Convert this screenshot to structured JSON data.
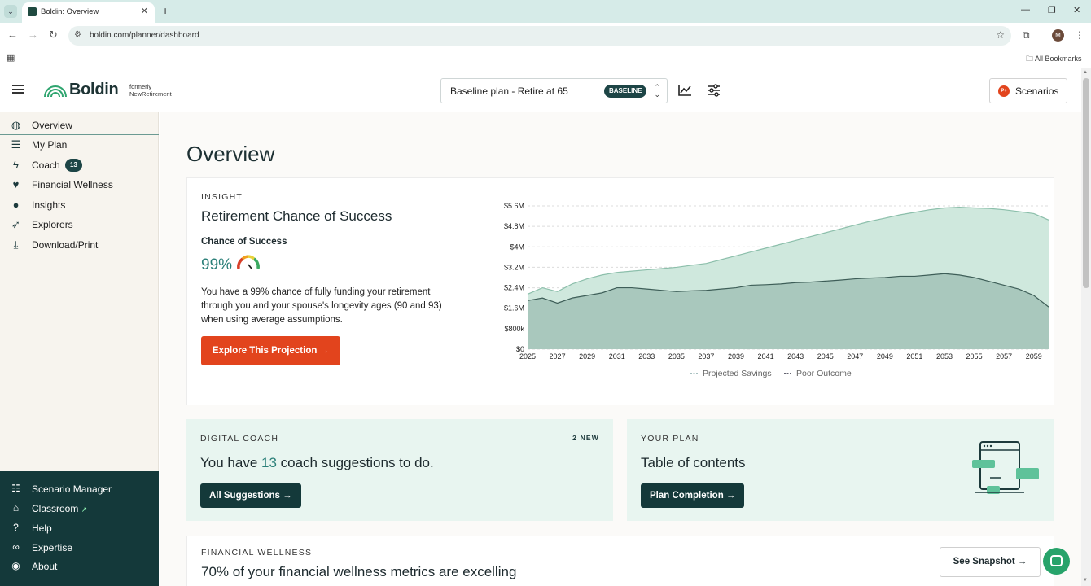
{
  "browser": {
    "tab_title": "Boldin: Overview",
    "tab_close": "✕",
    "new_tab": "+",
    "url": "boldin.com/planner/dashboard",
    "bookmarks_label": "All Bookmarks",
    "profile_initial": "M"
  },
  "header": {
    "brand": "Boldin",
    "formerly_line1": "formerly",
    "formerly_line2": "NewRetirement",
    "plan_name": "Baseline plan - Retire at 65",
    "plan_badge": "BASELINE",
    "scenarios_label": "Scenarios",
    "scenarios_icon_text": "P+"
  },
  "sidebar": {
    "items": [
      {
        "label": "Overview",
        "icon": "globe-icon"
      },
      {
        "label": "My Plan",
        "icon": "checklist-icon"
      },
      {
        "label": "Coach",
        "icon": "lightning-icon",
        "badge": "13"
      },
      {
        "label": "Financial Wellness",
        "icon": "heartbeat-icon"
      },
      {
        "label": "Insights",
        "icon": "lightbulb-icon"
      },
      {
        "label": "Explorers",
        "icon": "explorer-icon"
      },
      {
        "label": "Download/Print",
        "icon": "download-icon"
      }
    ],
    "bottom_items": [
      {
        "label": "Scenario Manager",
        "icon": "signpost-icon"
      },
      {
        "label": "Classroom",
        "icon": "graduation-cap-icon"
      },
      {
        "label": "Help",
        "icon": "question-icon"
      },
      {
        "label": "Expertise",
        "icon": "glasses-icon"
      },
      {
        "label": "About",
        "icon": "compass-icon"
      }
    ]
  },
  "main": {
    "page_title": "Overview",
    "insight": {
      "eyebrow": "INSIGHT",
      "title": "Retirement Chance of Success",
      "cos_label": "Chance of Success",
      "cos_value": "99%",
      "text": "You have a 99% chance of fully funding your retirement through you and your spouse's longevity ages (90 and 93) when using average assumptions.",
      "button_label": "Explore This Projection →"
    },
    "coach": {
      "eyebrow": "DIGITAL COACH",
      "new_tag": "2 NEW",
      "headline_before": "You have ",
      "headline_count": "13",
      "headline_after": " coach suggestions to do.",
      "button_label": "All Suggestions →"
    },
    "your_plan": {
      "eyebrow": "YOUR PLAN",
      "headline": "Table of contents",
      "button_label": "Plan Completion →"
    },
    "wellness": {
      "eyebrow": "FINANCIAL WELLNESS",
      "headline": "70% of your financial wellness metrics are excelling",
      "button_label": "See Snapshot →"
    }
  },
  "colors": {
    "accent_orange": "#e2441d",
    "dark_teal": "#14393a",
    "projected_fill": "#cfe8dd",
    "poor_fill": "#a9c8bd"
  },
  "chart_data": {
    "type": "area",
    "x": [
      2025,
      2026,
      2027,
      2028,
      2029,
      2030,
      2031,
      2032,
      2033,
      2034,
      2035,
      2036,
      2037,
      2038,
      2039,
      2040,
      2041,
      2042,
      2043,
      2044,
      2045,
      2046,
      2047,
      2048,
      2049,
      2050,
      2051,
      2052,
      2053,
      2054,
      2055,
      2056,
      2057,
      2058,
      2059,
      2060
    ],
    "x_tick_labels": [
      "2025",
      "2027",
      "2029",
      "2031",
      "2033",
      "2035",
      "2037",
      "2039",
      "2041",
      "2043",
      "2045",
      "2047",
      "2049",
      "2051",
      "2053",
      "2055",
      "2057",
      "2059"
    ],
    "y_tick_labels": [
      "$0",
      "$800k",
      "$1.6M",
      "$2.4M",
      "$3.2M",
      "$4M",
      "$4.8M",
      "$5.6M"
    ],
    "y_ticks": [
      0,
      0.8,
      1.6,
      2.4,
      3.2,
      4.0,
      4.8,
      5.6
    ],
    "ylim": [
      0,
      5.6
    ],
    "series": [
      {
        "name": "Projected Savings",
        "values": [
          2.15,
          2.4,
          2.25,
          2.55,
          2.75,
          2.9,
          3.0,
          3.05,
          3.1,
          3.15,
          3.2,
          3.28,
          3.35,
          3.5,
          3.65,
          3.8,
          3.95,
          4.1,
          4.25,
          4.4,
          4.55,
          4.7,
          4.85,
          5.0,
          5.12,
          5.25,
          5.35,
          5.45,
          5.52,
          5.55,
          5.52,
          5.5,
          5.45,
          5.38,
          5.3,
          5.05
        ]
      },
      {
        "name": "Poor Outcome",
        "values": [
          1.9,
          2.0,
          1.8,
          2.0,
          2.1,
          2.2,
          2.4,
          2.4,
          2.35,
          2.3,
          2.25,
          2.28,
          2.3,
          2.35,
          2.4,
          2.5,
          2.52,
          2.55,
          2.6,
          2.62,
          2.66,
          2.7,
          2.75,
          2.78,
          2.8,
          2.85,
          2.85,
          2.9,
          2.95,
          2.9,
          2.8,
          2.65,
          2.5,
          2.35,
          2.1,
          1.65
        ]
      }
    ],
    "legend_position": "bottom"
  }
}
